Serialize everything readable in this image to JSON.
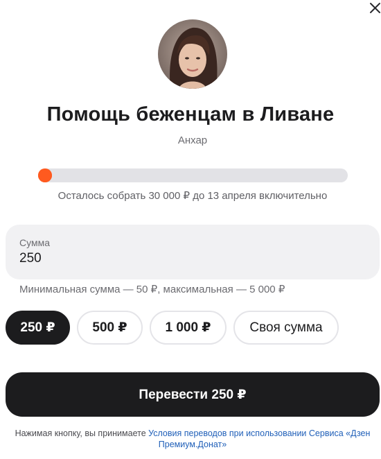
{
  "colors": {
    "accent": "#ff5a1f",
    "dark": "#1c1c1e",
    "track": "#e2e2e6",
    "link": "#1f5fb8"
  },
  "header": {
    "close_icon": "close-icon"
  },
  "fundraiser": {
    "title": "Помощь беженцам в Ливане",
    "author": "Анхар",
    "progress_fraction": 0.02,
    "progress_caption": "Осталось собрать 30 000 ₽ до 13 апреля включительно"
  },
  "amount": {
    "label": "Сумма",
    "value": "250",
    "hint": "Минимальная сумма — 50 ₽, максимальная — 5 000 ₽"
  },
  "presets": [
    {
      "label": "250 ₽",
      "selected": true
    },
    {
      "label": "500 ₽",
      "selected": false
    },
    {
      "label": "1 000 ₽",
      "selected": false
    },
    {
      "label": "Своя сумма",
      "selected": false
    }
  ],
  "submit": {
    "label": "Перевести 250 ₽"
  },
  "terms": {
    "prefix": "Нажимая кнопку, вы принимаете ",
    "link": "Условия переводов при использовании Сервиса «Дзен Премиум.Донат»"
  }
}
